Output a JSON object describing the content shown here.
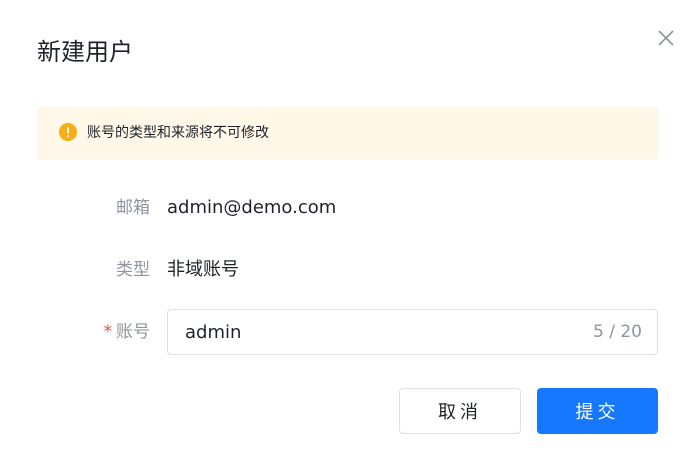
{
  "dialog": {
    "title": "新建用户",
    "close_icon": "close-icon"
  },
  "notice": {
    "icon": "warning-icon",
    "icon_color": "#faad14",
    "background_color": "#fff8e8",
    "text": "账号的类型和来源将不可修改"
  },
  "fields": {
    "email": {
      "label": "邮箱",
      "value": "admin@demo.com"
    },
    "type": {
      "label": "类型",
      "value": "非域账号"
    },
    "account": {
      "required_mark": "*",
      "label": "账号",
      "value": "admin",
      "char_count": "5 / 20"
    }
  },
  "buttons": {
    "cancel_label": "取消",
    "submit_label": "提交"
  },
  "colors": {
    "primary": "#1677ff",
    "required": "#f54a45",
    "label": "#8f959e"
  }
}
